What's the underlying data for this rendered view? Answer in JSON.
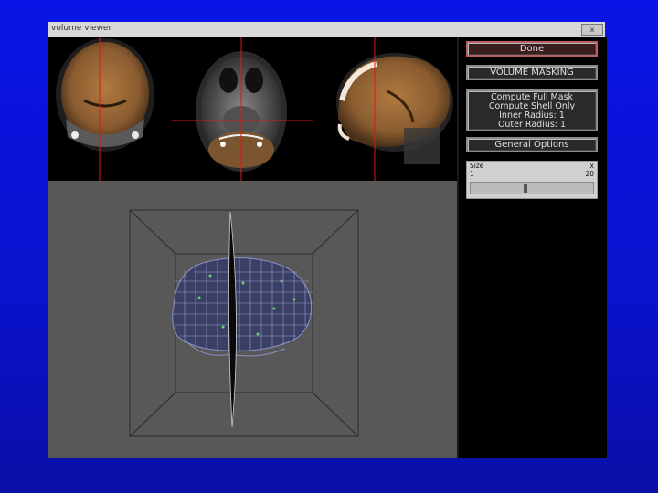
{
  "window": {
    "title": "volume viewer",
    "close_label": "x"
  },
  "panel": {
    "done_label": "Done",
    "volume_masking_label": "VOLUME MASKING",
    "options": [
      "Compute Full Mask",
      "Compute Shell Only",
      "Inner Radius: 1",
      "Outer Radius: 1"
    ],
    "general_options_label": "General Options",
    "slider": {
      "label": "Size",
      "close": "x",
      "min": "1",
      "max": "20",
      "value": 9
    }
  },
  "colors": {
    "background": "#0a12cc",
    "done_border": "#b86060",
    "crosshair": "#e01818",
    "tissue": "#c08040"
  }
}
